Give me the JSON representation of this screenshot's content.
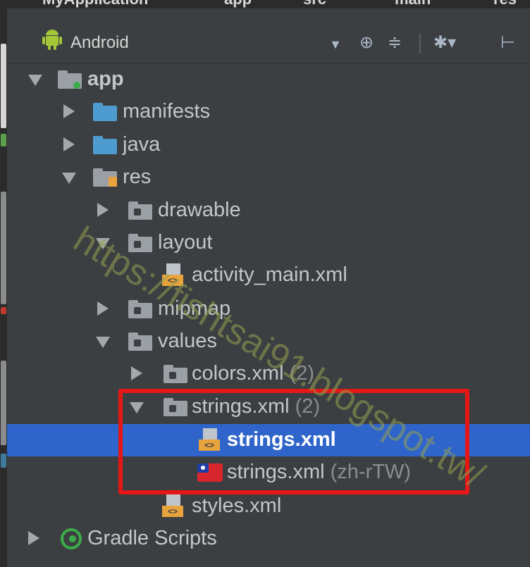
{
  "breadcrumb": {
    "items": [
      "MyApplication",
      "app",
      "src",
      "main",
      "res"
    ]
  },
  "toolbar": {
    "view_label": "Android",
    "icons": [
      "dropdown-arrow-icon",
      "target-icon",
      "collapse-icon",
      "gear-icon",
      "hide-icon"
    ]
  },
  "tree": {
    "rows": [
      {
        "label": "app",
        "count": "",
        "icon": "module-folder-icon",
        "expanded": true
      },
      {
        "label": "manifests",
        "count": "",
        "icon": "folder-icon"
      },
      {
        "label": "java",
        "count": "",
        "icon": "source-folder-icon"
      },
      {
        "label": "res",
        "count": "",
        "icon": "resource-folder-icon",
        "expanded": true
      },
      {
        "label": "drawable",
        "count": "",
        "icon": "folder-icon"
      },
      {
        "label": "layout",
        "count": "",
        "icon": "folder-icon",
        "expanded": true
      },
      {
        "label": "activity_main.xml",
        "count": "",
        "icon": "xml-file-icon"
      },
      {
        "label": "mipmap",
        "count": "",
        "icon": "folder-icon"
      },
      {
        "label": "values",
        "count": "",
        "icon": "folder-icon",
        "expanded": true
      },
      {
        "label": "colors.xml",
        "count": "(2)",
        "icon": "folder-icon"
      },
      {
        "label": "strings.xml",
        "count": "(2)",
        "icon": "folder-icon",
        "expanded": true
      },
      {
        "label": "strings.xml",
        "count": "",
        "icon": "xml-file-icon",
        "selected": true
      },
      {
        "label": "strings.xml",
        "count": "(zh-rTW)",
        "icon": "taiwan-flag-icon"
      },
      {
        "label": "styles.xml",
        "count": "",
        "icon": "xml-file-icon"
      },
      {
        "label": "Gradle Scripts",
        "count": "",
        "icon": "gradle-icon"
      }
    ]
  },
  "watermark": "https://fishtsai91.blogspot.tw/",
  "colors": {
    "background": "#3c3f41",
    "selection": "#2f65ca",
    "highlight_box": "#e51616",
    "text": "#c4c7ca"
  }
}
